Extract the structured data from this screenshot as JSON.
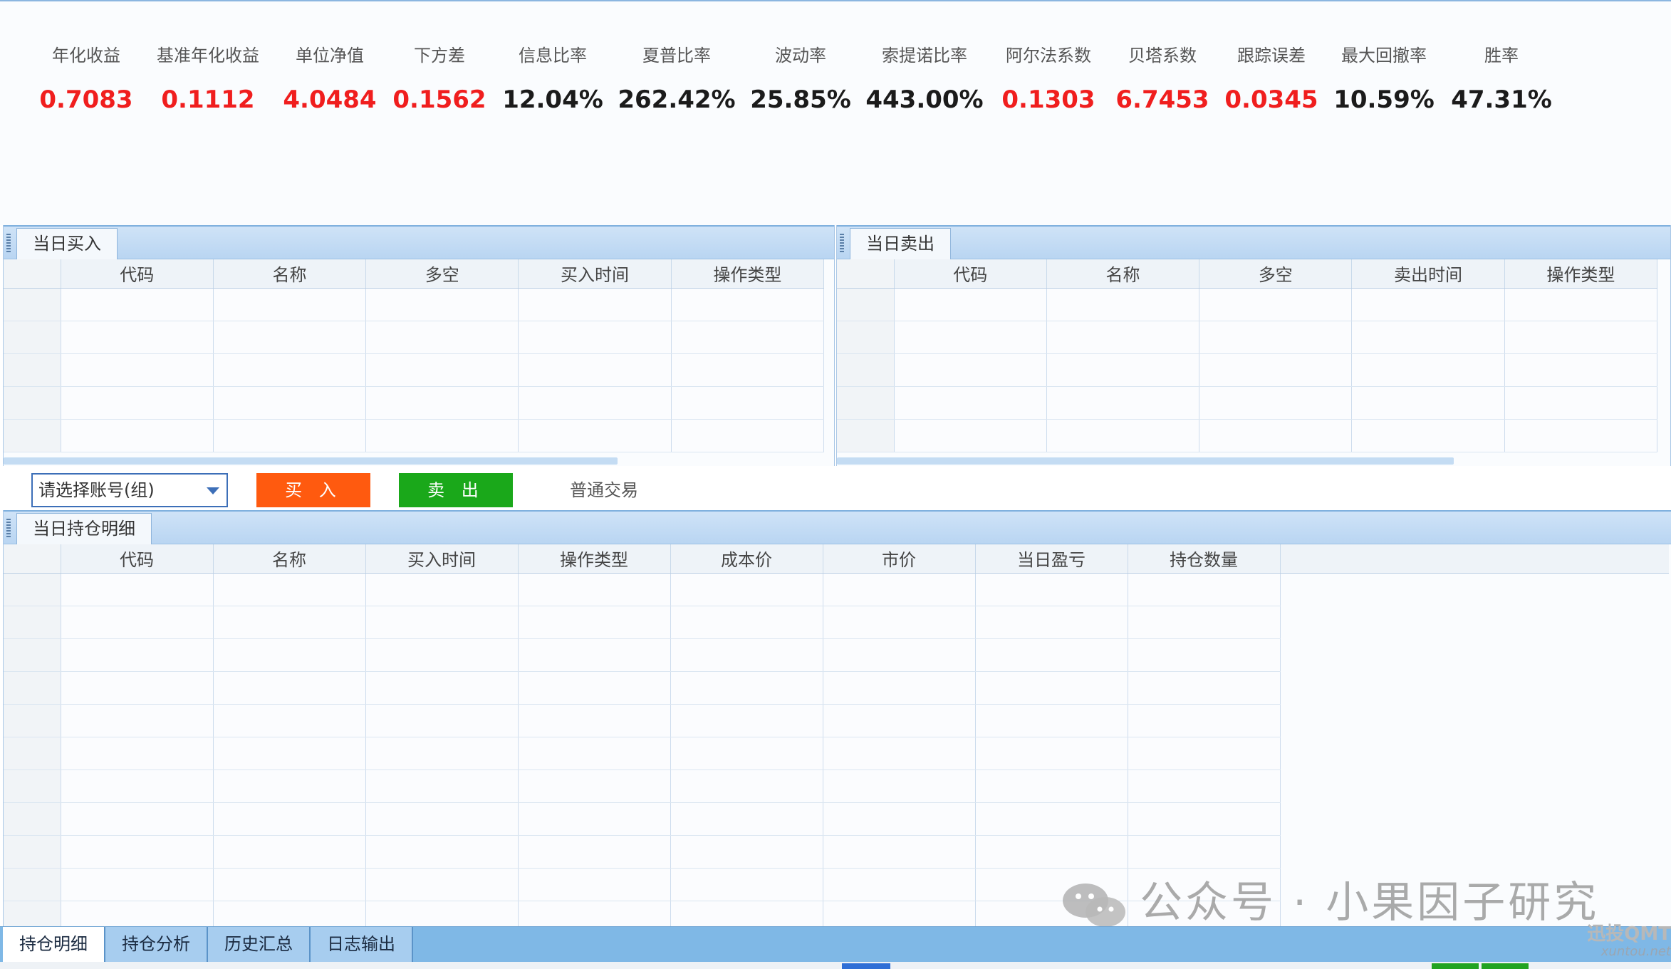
{
  "metrics": [
    {
      "label": "年化收益",
      "value": "0.7083",
      "color": "red"
    },
    {
      "label": "基准年化收益",
      "value": "0.1112",
      "color": "red"
    },
    {
      "label": "单位净值",
      "value": "4.0484",
      "color": "red"
    },
    {
      "label": "下方差",
      "value": "0.1562",
      "color": "red"
    },
    {
      "label": "信息比率",
      "value": "12.04%",
      "color": "dark"
    },
    {
      "label": "夏普比率",
      "value": "262.42%",
      "color": "dark"
    },
    {
      "label": "波动率",
      "value": "25.85%",
      "color": "dark"
    },
    {
      "label": "索提诺比率",
      "value": "443.00%",
      "color": "dark"
    },
    {
      "label": "阿尔法系数",
      "value": "0.1303",
      "color": "red"
    },
    {
      "label": "贝塔系数",
      "value": "6.7453",
      "color": "red"
    },
    {
      "label": "跟踪误差",
      "value": "0.0345",
      "color": "red"
    },
    {
      "label": "最大回撤率",
      "value": "10.59%",
      "color": "dark"
    },
    {
      "label": "胜率",
      "value": "47.31%",
      "color": "dark"
    }
  ],
  "buy_panel": {
    "tab": "当日买入",
    "columns": [
      "代码",
      "名称",
      "多空",
      "买入时间",
      "操作类型"
    ]
  },
  "sell_panel": {
    "tab": "当日卖出",
    "columns": [
      "代码",
      "名称",
      "多空",
      "卖出时间",
      "操作类型"
    ]
  },
  "controls": {
    "account_placeholder": "请选择账号(组)",
    "buy_label": "买 入",
    "sell_label": "卖 出",
    "mode_label": "普通交易"
  },
  "positions_panel": {
    "tab": "当日持仓明细",
    "columns": [
      "代码",
      "名称",
      "买入时间",
      "操作类型",
      "成本价",
      "市价",
      "当日盈亏",
      "持仓数量"
    ]
  },
  "bottom_tabs": [
    "持仓明细",
    "持仓分析",
    "历史汇总",
    "日志输出"
  ],
  "watermark": {
    "text": "公众号 · 小果因子研究",
    "brand": "迅投QMT",
    "brand_sub": "xuntou.net"
  },
  "colors": {
    "value_red": "#f01e1e",
    "value_dark": "#1b1b1b",
    "buy_button": "#ff5a0f",
    "sell_button": "#1aa81a",
    "header_blue": "#b9d5f2"
  }
}
